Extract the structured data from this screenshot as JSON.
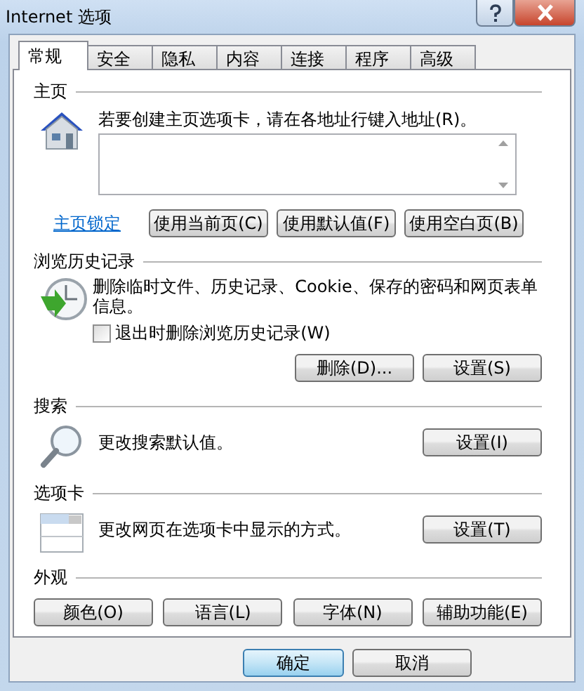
{
  "window": {
    "title": "Internet 选项"
  },
  "tabs": [
    {
      "label": "常规",
      "selected": true
    },
    {
      "label": "安全",
      "selected": false
    },
    {
      "label": "隐私",
      "selected": false
    },
    {
      "label": "内容",
      "selected": false
    },
    {
      "label": "连接",
      "selected": false
    },
    {
      "label": "程序",
      "selected": false
    },
    {
      "label": "高级",
      "selected": false
    }
  ],
  "sections": [
    {
      "kind": "homepage",
      "title": "主页",
      "description": "若要创建主页选项卡，请在各地址行键入地址(R)。",
      "link": "主页锁定",
      "buttons": [
        "使用当前页(C)",
        "使用默认值(F)",
        "使用空白页(B)"
      ]
    },
    {
      "kind": "history",
      "title": "浏览历史记录",
      "description": "删除临时文件、历史记录、Cookie、保存的密码和网页表单信息。",
      "checkbox": {
        "label": "退出时删除浏览历史记录(W)",
        "checked": false
      },
      "buttons": [
        "删除(D)...",
        "设置(S)"
      ]
    },
    {
      "kind": "search",
      "title": "搜索",
      "description": "更改搜索默认值。",
      "buttons": [
        "设置(I)"
      ]
    },
    {
      "kind": "tabs",
      "title": "选项卡",
      "description": "更改网页在选项卡中显示的方式。",
      "buttons": [
        "设置(T)"
      ]
    },
    {
      "kind": "appearance",
      "title": "外观",
      "buttons": [
        "颜色(O)",
        "语言(L)",
        "字体(N)",
        "辅助功能(E)"
      ]
    }
  ],
  "footer_buttons": [
    {
      "label": "确定",
      "default": true
    },
    {
      "label": "取消",
      "default": false
    }
  ]
}
